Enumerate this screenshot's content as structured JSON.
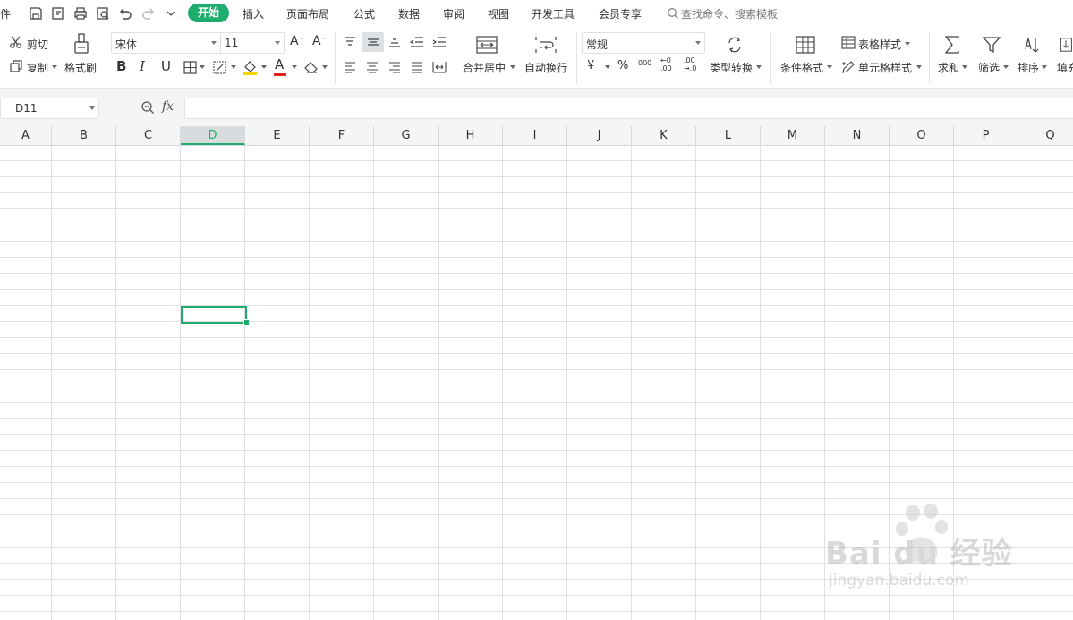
{
  "menubar": {
    "file_partial": "件",
    "tabs": [
      "开始",
      "插入",
      "页面布局",
      "公式",
      "数据",
      "审阅",
      "视图",
      "开发工具",
      "会员专享"
    ],
    "search_placeholder": "查找命令、搜索模板"
  },
  "ribbon": {
    "cut": "剪切",
    "copy": "复制",
    "format_painter": "格式刷",
    "font_name": "宋体",
    "font_size": "11",
    "merge_center": "合并居中",
    "wrap_text": "自动换行",
    "number_format": "常规",
    "currency_symbol": "¥",
    "percent_symbol": "%",
    "thousands": "000",
    "inc_decimal": "←0 .00",
    "dec_decimal": ".00 →.0",
    "type_convert": "类型转换",
    "conditional_format": "条件格式",
    "table_style": "表格样式",
    "cell_style": "单元格样式",
    "sum": "求和",
    "filter": "筛选",
    "sort": "排序",
    "fill_partial": "填充",
    "bold": "B",
    "italic": "I",
    "underline": "U",
    "font_color_letter": "A",
    "grow_font": "A⁺",
    "shrink_font": "A⁻"
  },
  "formula": {
    "cell_ref": "D11",
    "fx": "fx",
    "value": ""
  },
  "sheet": {
    "columns": [
      "A",
      "B",
      "C",
      "D",
      "E",
      "F",
      "G",
      "H",
      "I",
      "J",
      "K",
      "L",
      "M",
      "N",
      "O",
      "P",
      "Q"
    ],
    "selected_column": "D",
    "active_cell": "D11"
  },
  "watermark": {
    "brand": "Bai du 经验",
    "url": "jingyan.baidu.com"
  },
  "colors": {
    "accent": "#1fad6e",
    "grid_line": "#dde0e4",
    "header_bg": "#f4f5f7"
  }
}
